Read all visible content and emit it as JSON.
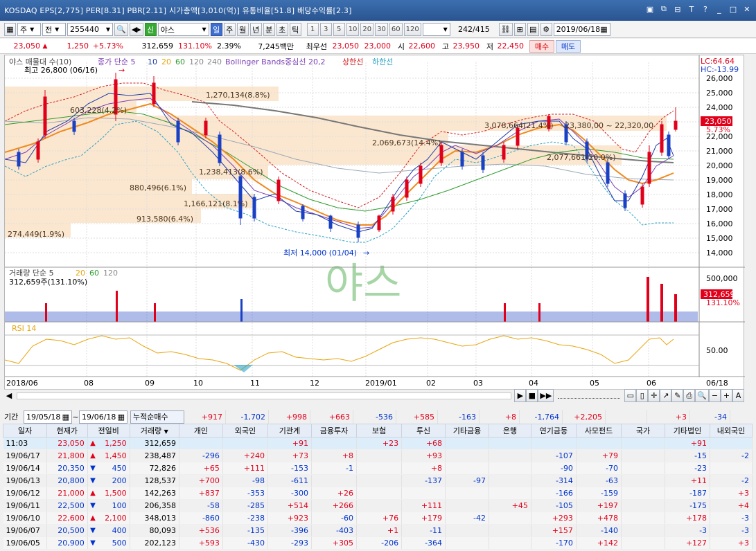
{
  "titlebar": {
    "text": "KOSDAQ EPS[2,775] PER[8.31] PBR[2.11] 시가총액[3,010(억)] 유통비율[51.8] 배당수익률[2.3]",
    "window_icons": [
      "restore-icon",
      "tile-icon",
      "pin-icon",
      "font-icon",
      "help-icon",
      "minimize-icon",
      "maximize-icon",
      "close-icon"
    ]
  },
  "toolbar": {
    "mode": "주",
    "market": "전",
    "code": "255440",
    "name": "야스",
    "new_badge": "신",
    "periods": [
      "일",
      "주",
      "월",
      "년",
      "분",
      "초",
      "틱"
    ],
    "active_period": "일",
    "minute_options": [
      "1",
      "3",
      "5",
      "10",
      "20",
      "30",
      "60",
      "120"
    ],
    "range": "242/415",
    "date": "2019/06/18"
  },
  "quote": {
    "price": "23,050",
    "change": "1,250",
    "rate": "+5.73%",
    "volume": "312,659",
    "vol_ratio": "131.10%",
    "turnover": "2.39%",
    "amount": "7,245백만",
    "best_ask_label": "최우선",
    "best_ask": "23,050",
    "best_bid": "23,000",
    "open_label": "시",
    "open": "22,600",
    "high_label": "고",
    "high": "23,950",
    "low_label": "저",
    "low": "22,450",
    "buy_label": "매수",
    "sell_label": "매도"
  },
  "chart": {
    "legend_name": "야스 매물대 수(10)",
    "legend_ma": "종가 단순 5",
    "legend_ma_periods": [
      "10",
      "20",
      "60",
      "120",
      "240"
    ],
    "legend_bb": "Bollinger Bands중심선 20,2",
    "legend_upper": "상한선",
    "legend_lower": "하한선",
    "lc": "LC:64.64",
    "hc": "HC:-13.99",
    "high_note": "최고 26,800 (06/16)",
    "low_note": "최저 14,000 (01/04)",
    "price_tag": "23,050",
    "price_rate_tag": "5.73%",
    "watermark": "야스",
    "price_axis": [
      "26,000",
      "25,000",
      "24,000",
      "23,000",
      "22,000",
      "21,000",
      "20,000",
      "19,000",
      "18,000",
      "17,000",
      "16,000",
      "15,000",
      "14,000"
    ],
    "volume_profile": [
      "1,270,134(8.8%)",
      "603,228(4.2%)",
      "3,078,664(21.4%)",
      "2,069,673(14.4%)",
      "2,077,661(20.0%)",
      "1,238,413(8.6%)",
      "880,496(6.1%)",
      "1,166,121(8.1%)",
      "913,580(6.4%)",
      "274,449(1.9%)"
    ],
    "range_note": "23,380,00 ~ 22,320,00",
    "volume_legend": "거래량  단순 5",
    "volume_legend_periods": [
      "20",
      "60",
      "120"
    ],
    "volume_value": "312,659주(131.10%)",
    "volume_axis": "500,000",
    "volume_tag": "312,659",
    "volume_rate_tag": "131.10%",
    "rsi_legend": "RSI 14",
    "rsi_axis": "50.00",
    "date_axis": [
      "2018/06",
      "08",
      "09",
      "10",
      "11",
      "12",
      "2019/01",
      "02",
      "03",
      "04",
      "05",
      "06",
      "06/18"
    ]
  },
  "filter": {
    "label": "기간",
    "from": "19/05/18",
    "to": "19/06/18",
    "mode": "누적순매수",
    "totals": [
      "+917",
      "-1,702",
      "+998",
      "+663",
      "-536",
      "+585",
      "-163",
      "+8",
      "-1,764",
      "+2,205",
      "",
      "+3",
      "-34"
    ]
  },
  "table": {
    "headers": [
      "일자",
      "현재가",
      "전일비",
      "거래량",
      "개인",
      "외국인",
      "기관계",
      "금융투자",
      "보험",
      "투신",
      "기타금융",
      "은행",
      "연기금등",
      "사모펀드",
      "국가",
      "기타법인",
      "내외국인"
    ],
    "rows": [
      [
        "11:03",
        "23,050",
        "▲",
        "1,250",
        "312,659",
        "",
        "",
        "+91",
        "",
        "+23",
        "+68",
        "",
        "",
        "",
        "",
        "",
        "+91",
        ""
      ],
      [
        "19/06/17",
        "21,800",
        "▲",
        "1,450",
        "238,487",
        "-296",
        "+240",
        "+73",
        "+8",
        "",
        "+93",
        "",
        "",
        "-107",
        "+79",
        "",
        "-15",
        "-2"
      ],
      [
        "19/06/14",
        "20,350",
        "▼",
        "450",
        "72,826",
        "+65",
        "+111",
        "-153",
        "-1",
        "",
        "+8",
        "",
        "",
        "-90",
        "-70",
        "",
        "-23",
        ""
      ],
      [
        "19/06/13",
        "20,800",
        "▼",
        "200",
        "128,537",
        "+700",
        "-98",
        "-611",
        "",
        "",
        "-137",
        "-97",
        "",
        "-314",
        "-63",
        "",
        "+11",
        "-2"
      ],
      [
        "19/06/12",
        "21,000",
        "▲",
        "1,500",
        "142,263",
        "+837",
        "-353",
        "-300",
        "+26",
        "",
        "",
        "",
        "",
        "-166",
        "-159",
        "",
        "-187",
        "+3"
      ],
      [
        "19/06/11",
        "22,500",
        "▼",
        "100",
        "206,358",
        "-58",
        "-285",
        "+514",
        "+266",
        "",
        "+111",
        "",
        "+45",
        "-105",
        "+197",
        "",
        "-175",
        "+4"
      ],
      [
        "19/06/10",
        "22,600",
        "▲",
        "2,100",
        "348,013",
        "-860",
        "-238",
        "+923",
        "-60",
        "+76",
        "+179",
        "-42",
        "",
        "+293",
        "+478",
        "",
        "+178",
        "-3"
      ],
      [
        "19/06/07",
        "20,500",
        "▼",
        "400",
        "80,093",
        "+536",
        "-135",
        "-396",
        "-403",
        "+1",
        "-11",
        "",
        "",
        "+157",
        "-140",
        "",
        "-3",
        "-3"
      ],
      [
        "19/06/05",
        "20,900",
        "▼",
        "500",
        "202,123",
        "+593",
        "-430",
        "-293",
        "+305",
        "-206",
        "-364",
        "",
        "",
        "-170",
        "+142",
        "",
        "+127",
        "+3"
      ]
    ]
  }
}
